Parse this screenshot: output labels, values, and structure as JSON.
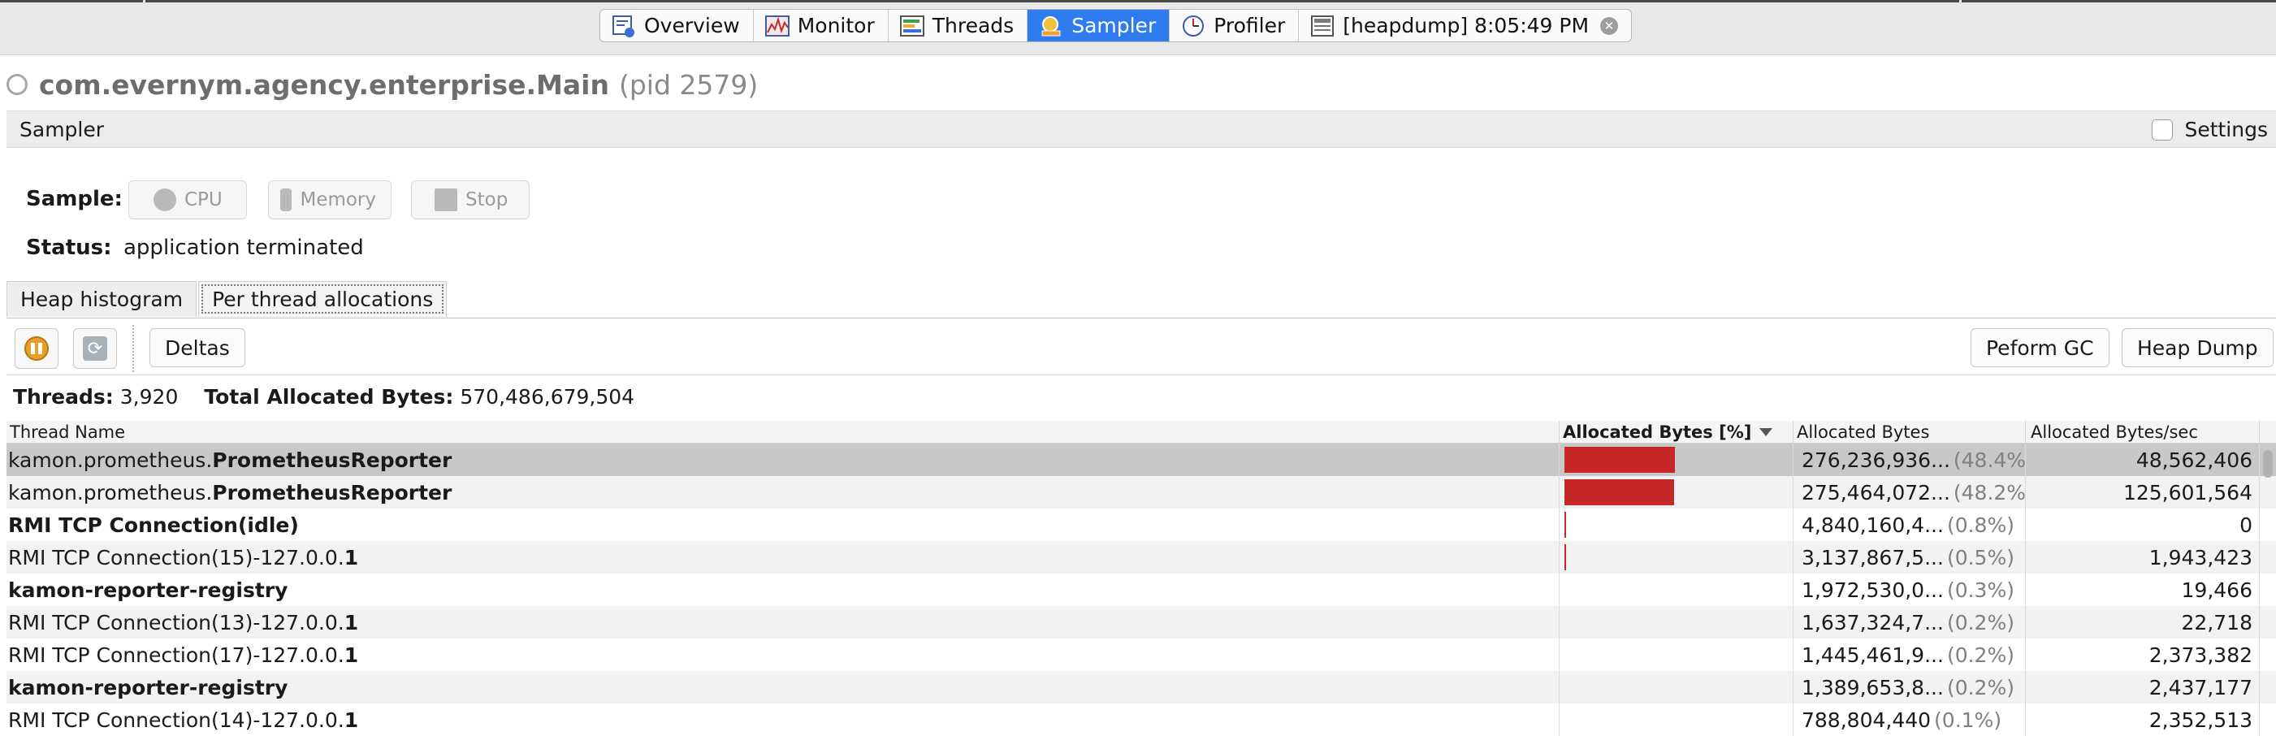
{
  "top_tabs": [
    {
      "label": "Overview",
      "icon": "overview-icon",
      "active": false
    },
    {
      "label": "Monitor",
      "icon": "monitor-icon",
      "active": false
    },
    {
      "label": "Threads",
      "icon": "threads-icon",
      "active": false
    },
    {
      "label": "Sampler",
      "icon": "sampler-icon",
      "active": true
    },
    {
      "label": "Profiler",
      "icon": "profiler-icon",
      "active": false
    },
    {
      "label": "[heapdump] 8:05:49 PM",
      "icon": "heapdump-icon",
      "active": false
    }
  ],
  "title": {
    "main": "com.evernym.agency.enterprise.Main",
    "pid": "(pid 2579)"
  },
  "sampler": {
    "header": "Sampler",
    "settings_label": "Settings"
  },
  "sample": {
    "label": "Sample:",
    "cpu": "CPU",
    "memory": "Memory",
    "stop": "Stop"
  },
  "status": {
    "label": "Status:",
    "value": "application terminated"
  },
  "sub_tabs": {
    "heap": "Heap histogram",
    "per_thread": "Per thread allocations"
  },
  "toolbar": {
    "deltas": "Deltas",
    "gc": "Peform GC",
    "heap_dump": "Heap Dump"
  },
  "summary": {
    "threads_label": "Threads:",
    "threads_value": "3,920",
    "total_label": "Total Allocated Bytes:",
    "total_value": "570,486,679,504"
  },
  "table": {
    "columns": [
      "Thread Name",
      "Allocated Bytes [%]",
      "Allocated Bytes",
      "Allocated Bytes/sec"
    ],
    "rows": [
      {
        "name_prefix": "kamon.prometheus.",
        "name_bold": "PrometheusReporter",
        "name_suffix": "",
        "percent": 48.4,
        "bytes": "276,236,936...",
        "pct": "(48.4%)",
        "rate": "48,562,406",
        "selected": true
      },
      {
        "name_prefix": "kamon.prometheus.",
        "name_bold": "PrometheusReporter",
        "name_suffix": "",
        "percent": 48.2,
        "bytes": "275,464,072...",
        "pct": "(48.2%)",
        "rate": "125,601,564",
        "selected": false
      },
      {
        "name_prefix": "",
        "name_bold": "RMI TCP Connection(idle)",
        "name_suffix": "",
        "percent": 0.8,
        "bytes": "4,840,160,4...",
        "pct": "(0.8%)",
        "rate": "0",
        "selected": false
      },
      {
        "name_prefix": "RMI TCP Connection(15)-127.0.0.",
        "name_bold": "1",
        "name_suffix": "",
        "percent": 0.5,
        "bytes": "3,137,867,5...",
        "pct": "(0.5%)",
        "rate": "1,943,423",
        "selected": false
      },
      {
        "name_prefix": "",
        "name_bold": "kamon-reporter-registry",
        "name_suffix": "",
        "percent": 0.3,
        "bytes": "1,972,530,0...",
        "pct": "(0.3%)",
        "rate": "19,466",
        "selected": false
      },
      {
        "name_prefix": "RMI TCP Connection(13)-127.0.0.",
        "name_bold": "1",
        "name_suffix": "",
        "percent": 0.2,
        "bytes": "1,637,324,7...",
        "pct": "(0.2%)",
        "rate": "22,718",
        "selected": false
      },
      {
        "name_prefix": "RMI TCP Connection(17)-127.0.0.",
        "name_bold": "1",
        "name_suffix": "",
        "percent": 0.2,
        "bytes": "1,445,461,9...",
        "pct": "(0.2%)",
        "rate": "2,373,382",
        "selected": false
      },
      {
        "name_prefix": "",
        "name_bold": "kamon-reporter-registry",
        "name_suffix": "",
        "percent": 0.2,
        "bytes": "1,389,653,8...",
        "pct": "(0.2%)",
        "rate": "2,437,177",
        "selected": false
      },
      {
        "name_prefix": "RMI TCP Connection(14)-127.0.0.",
        "name_bold": "1",
        "name_suffix": "",
        "percent": 0.1,
        "bytes": "788,804,440",
        "pct": "(0.1%)",
        "rate": "2,352,513",
        "selected": false
      }
    ]
  },
  "colors": {
    "accent": "#2e7cf0",
    "bar": "#c62828"
  }
}
